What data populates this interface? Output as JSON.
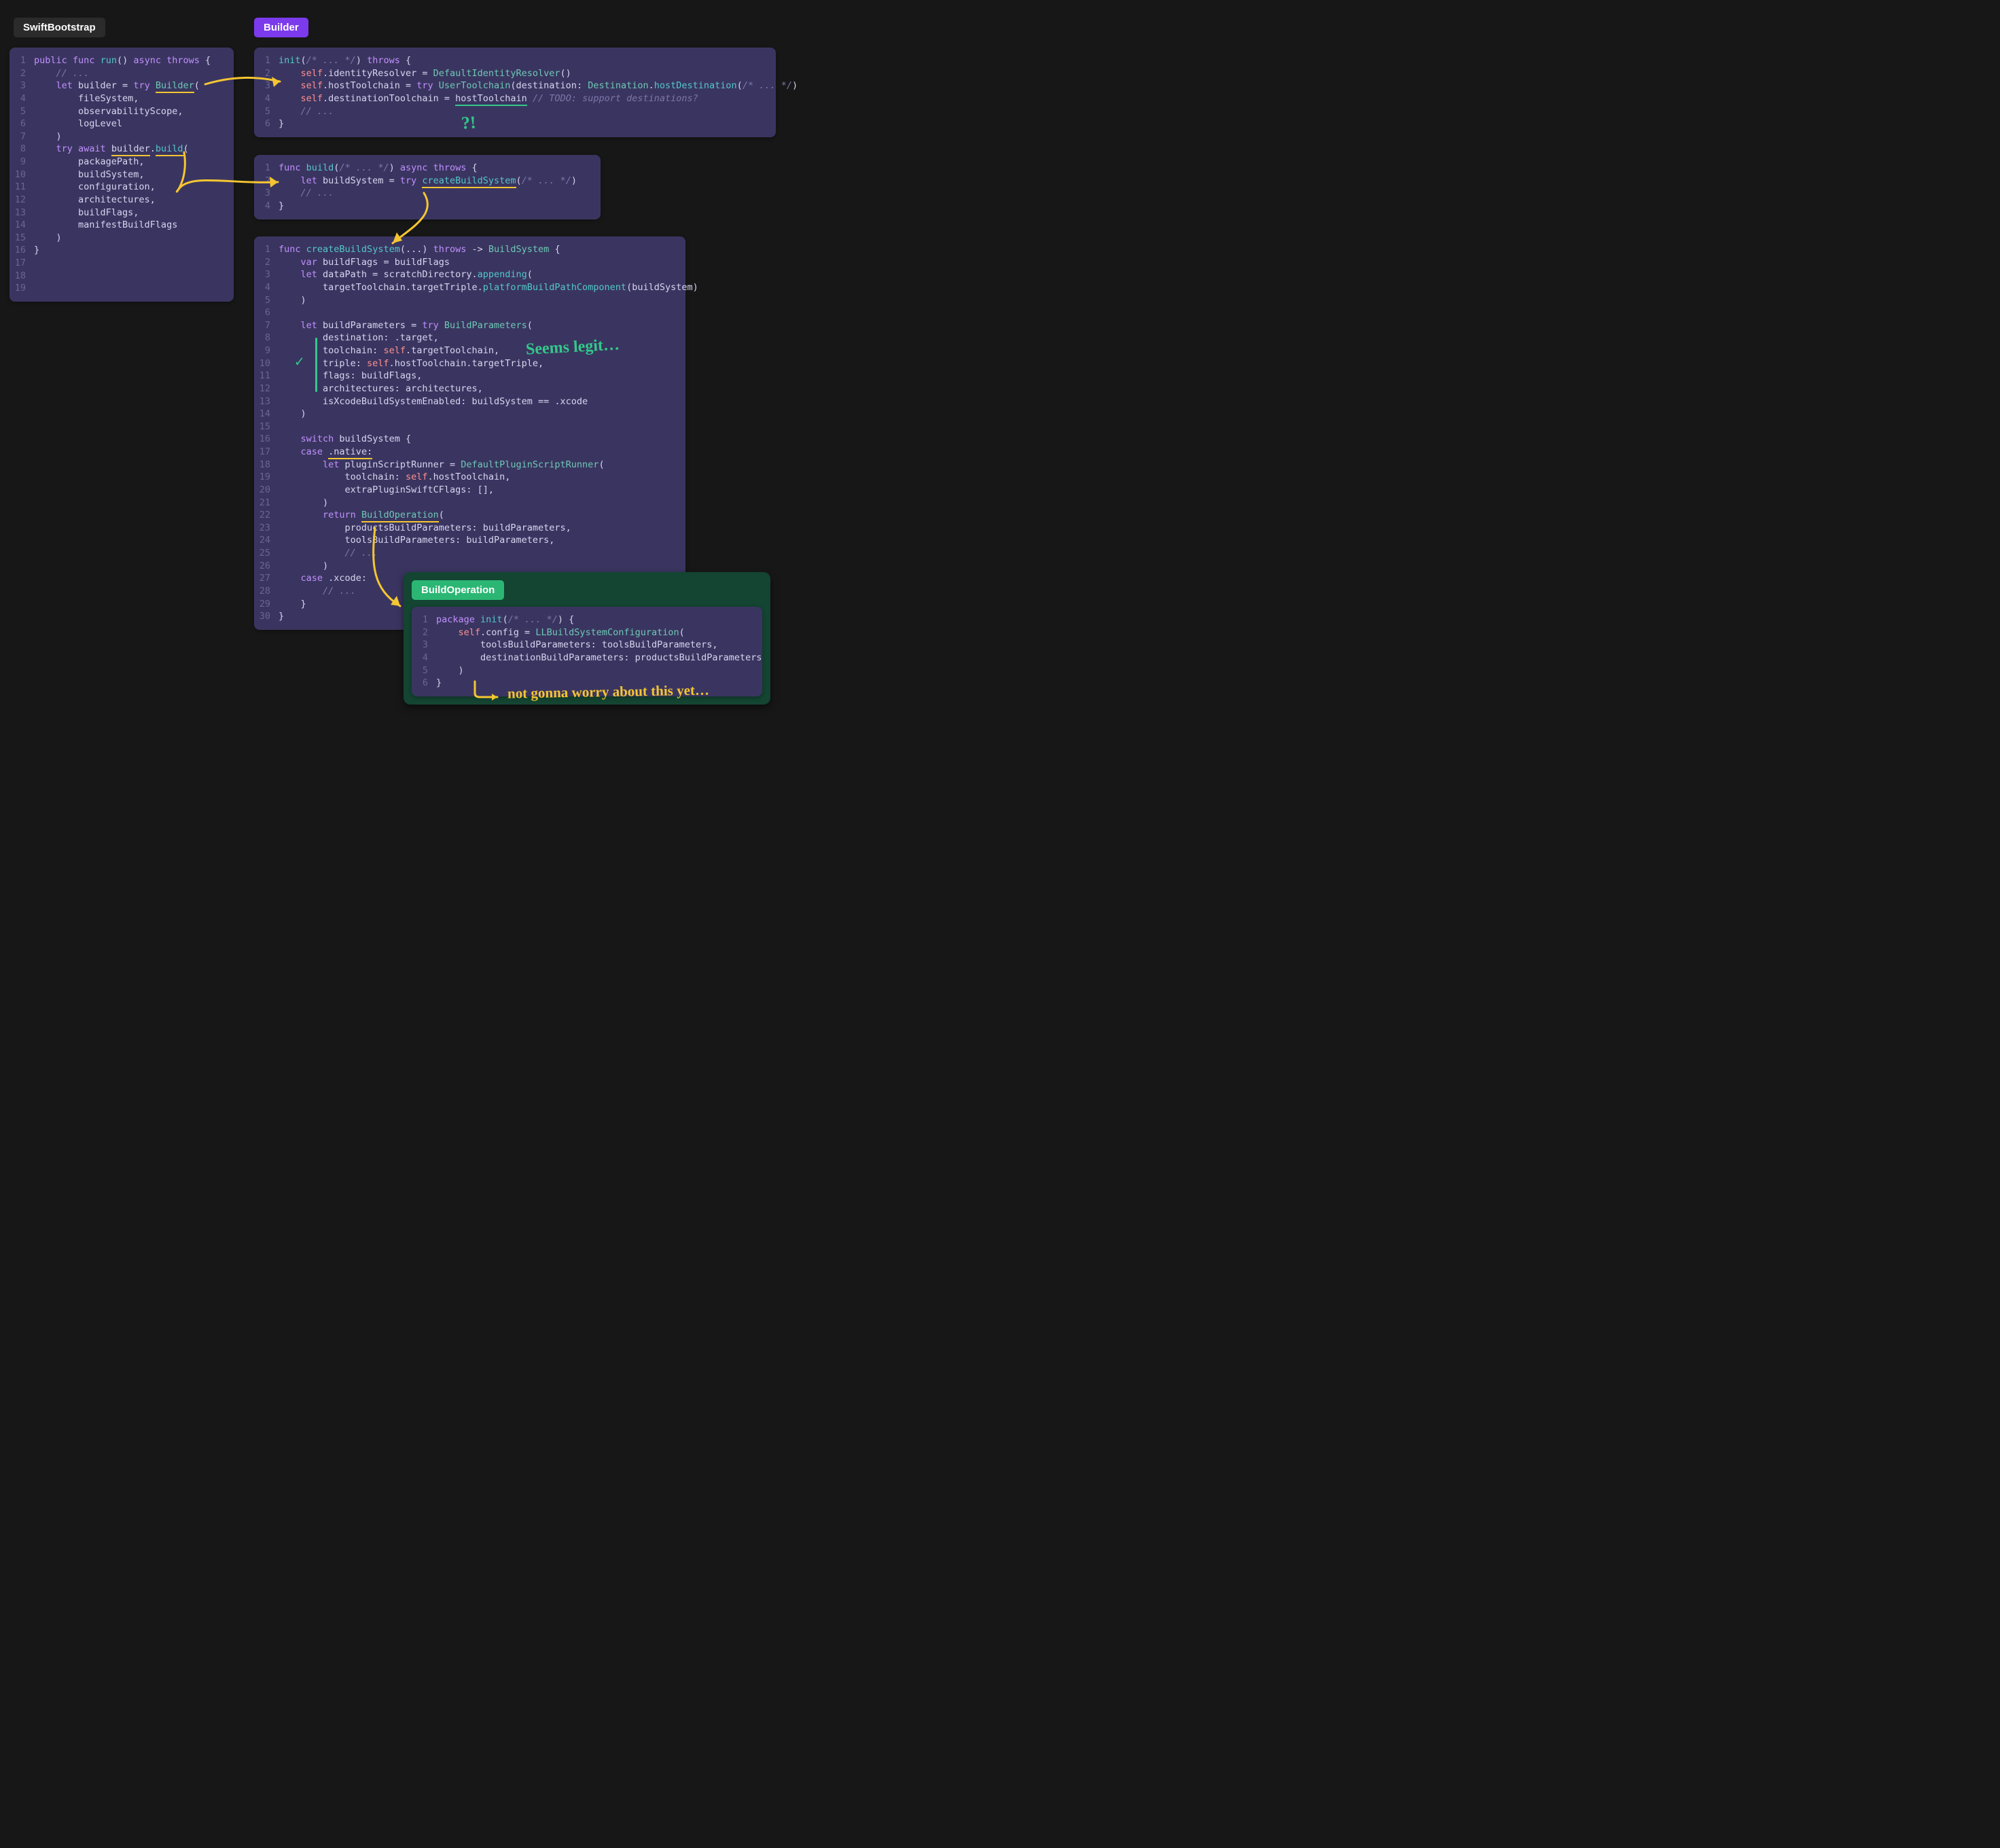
{
  "tabs": {
    "swift_bootstrap": "SwiftBootstrap",
    "builder": "Builder",
    "build_operation": "BuildOperation"
  },
  "annotations": {
    "question": "?!",
    "seems_legit": "Seems legit…",
    "not_worry": "not gonna worry about this yet…"
  },
  "panels": {
    "swift_bootstrap": {
      "lines": [
        {
          "n": 1,
          "html": "<span class='kw'>public</span> <span class='kw'>func</span> <span class='fn'>run</span>() <span class='kw'>async</span> <span class='kw'>throws</span> {"
        },
        {
          "n": 2,
          "html": "    <span class='cm'>// ...</span>"
        },
        {
          "n": 3,
          "html": "    <span class='kw'>let</span> builder = <span class='kw'>try</span> <span class='tp und-y'>Builder</span>("
        },
        {
          "n": 4,
          "html": "        fileSystem,"
        },
        {
          "n": 5,
          "html": "        observabilityScope,"
        },
        {
          "n": 6,
          "html": "        logLevel"
        },
        {
          "n": 7,
          "html": "    )"
        },
        {
          "n": 8,
          "html": "    <span class='kw'>try</span> <span class='kw'>await</span> <span class='und-y'>builder</span>.<span class='fn und-y'>build</span>("
        },
        {
          "n": 9,
          "html": "        packagePath,"
        },
        {
          "n": 10,
          "html": "        buildSystem,"
        },
        {
          "n": 11,
          "html": "        configuration,"
        },
        {
          "n": 12,
          "html": "        architectures,"
        },
        {
          "n": 13,
          "html": "        buildFlags,"
        },
        {
          "n": 14,
          "html": "        manifestBuildFlags"
        },
        {
          "n": 15,
          "html": "    )"
        },
        {
          "n": 16,
          "html": "}"
        },
        {
          "n": 17,
          "html": ""
        },
        {
          "n": 18,
          "html": ""
        },
        {
          "n": 19,
          "html": ""
        }
      ]
    },
    "builder_init": {
      "lines": [
        {
          "n": 1,
          "html": "<span class='fn'>init</span>(<span class='cm'>/* ... */</span>) <span class='kw'>throws</span> {"
        },
        {
          "n": 2,
          "html": "    <span class='slf'>self</span>.identityResolver = <span class='tp'>DefaultIdentityResolver</span>()"
        },
        {
          "n": 3,
          "html": "    <span class='slf'>self</span>.hostToolchain = <span class='kw'>try</span> <span class='tp'>UserToolchain</span>(destination: <span class='tp'>Destination</span>.<span class='fn'>hostDestination</span>(<span class='cm'>/* ... */</span>)"
        },
        {
          "n": 4,
          "html": "    <span class='slf'>self</span>.destinationToolchain = <span class='und-g'>hostToolchain</span> <span class='cm'>// TODO: support destinations?</span>"
        },
        {
          "n": 5,
          "html": "    <span class='cm'>// ...</span>"
        },
        {
          "n": 6,
          "html": "}"
        }
      ]
    },
    "builder_build": {
      "lines": [
        {
          "n": 1,
          "html": "<span class='kw'>func</span> <span class='fn'>build</span>(<span class='cm'>/* ... */</span>) <span class='kw'>async</span> <span class='kw'>throws</span> {"
        },
        {
          "n": 2,
          "html": "    <span class='kw'>let</span> buildSystem = <span class='kw'>try</span> <span class='fn und-y'>createBuildSystem</span>(<span class='cm'>/* ... */</span>)"
        },
        {
          "n": 3,
          "html": "    <span class='cm'>// ...</span>"
        },
        {
          "n": 4,
          "html": "}"
        }
      ]
    },
    "create_build_system": {
      "lines": [
        {
          "n": 1,
          "html": "<span class='kw'>func</span> <span class='fn'>createBuildSystem</span>(...) <span class='kw'>throws</span> -&gt; <span class='tp'>BuildSystem</span> {"
        },
        {
          "n": 2,
          "html": "    <span class='kw'>var</span> buildFlags = buildFlags"
        },
        {
          "n": 3,
          "html": "    <span class='kw'>let</span> dataPath = scratchDirectory.<span class='fn'>appending</span>("
        },
        {
          "n": 4,
          "html": "        targetToolchain.targetTriple.<span class='fn'>platformBuildPathComponent</span>(buildSystem)"
        },
        {
          "n": 5,
          "html": "    )"
        },
        {
          "n": 6,
          "html": ""
        },
        {
          "n": 7,
          "html": "    <span class='kw'>let</span> buildParameters = <span class='kw'>try</span> <span class='tp'>BuildParameters</span>("
        },
        {
          "n": 8,
          "html": "        destination: .target,"
        },
        {
          "n": 9,
          "html": "        toolchain: <span class='slf'>self</span>.targetToolchain,"
        },
        {
          "n": 10,
          "html": "        triple: <span class='slf'>self</span>.hostToolchain.targetTriple,"
        },
        {
          "n": 11,
          "html": "        flags: buildFlags,"
        },
        {
          "n": 12,
          "html": "        architectures: architectures,"
        },
        {
          "n": 13,
          "html": "        isXcodeBuildSystemEnabled: buildSystem == .xcode"
        },
        {
          "n": 14,
          "html": "    )"
        },
        {
          "n": 15,
          "html": ""
        },
        {
          "n": 16,
          "html": "    <span class='kw'>switch</span> buildSystem {"
        },
        {
          "n": 17,
          "html": "    <span class='kw'>case</span> <span class='und-y'>.native:</span>"
        },
        {
          "n": 18,
          "html": "        <span class='kw'>let</span> pluginScriptRunner = <span class='tp'>DefaultPluginScriptRunner</span>("
        },
        {
          "n": 19,
          "html": "            toolchain: <span class='slf'>self</span>.hostToolchain,"
        },
        {
          "n": 20,
          "html": "            extraPluginSwiftCFlags: [],"
        },
        {
          "n": 21,
          "html": "        )"
        },
        {
          "n": 22,
          "html": "        <span class='kw'>return</span> <span class='tp und-y'>BuildOperation</span>("
        },
        {
          "n": 23,
          "html": "            productsBuildParameters: buildParameters,"
        },
        {
          "n": 24,
          "html": "            toolsBuildParameters: buildParameters,"
        },
        {
          "n": 25,
          "html": "            <span class='cm'>// ...</span>"
        },
        {
          "n": 26,
          "html": "        )"
        },
        {
          "n": 27,
          "html": "    <span class='kw'>case</span> .xcode:"
        },
        {
          "n": 28,
          "html": "        <span class='cm'>// ...</span>"
        },
        {
          "n": 29,
          "html": "    }"
        },
        {
          "n": 30,
          "html": "}"
        }
      ]
    },
    "build_operation": {
      "lines": [
        {
          "n": 1,
          "html": "<span class='kw'>package</span> <span class='fn'>init</span>(<span class='cm'>/* ... */</span>) {"
        },
        {
          "n": 2,
          "html": "    <span class='slf'>self</span>.config = <span class='tp'>LLBuildSystemConfiguration</span>("
        },
        {
          "n": 3,
          "html": "        toolsBuildParameters: toolsBuildParameters,"
        },
        {
          "n": 4,
          "html": "        destinationBuildParameters: productsBuildParameters"
        },
        {
          "n": 5,
          "html": "    )"
        },
        {
          "n": 6,
          "html": "}"
        }
      ]
    }
  }
}
